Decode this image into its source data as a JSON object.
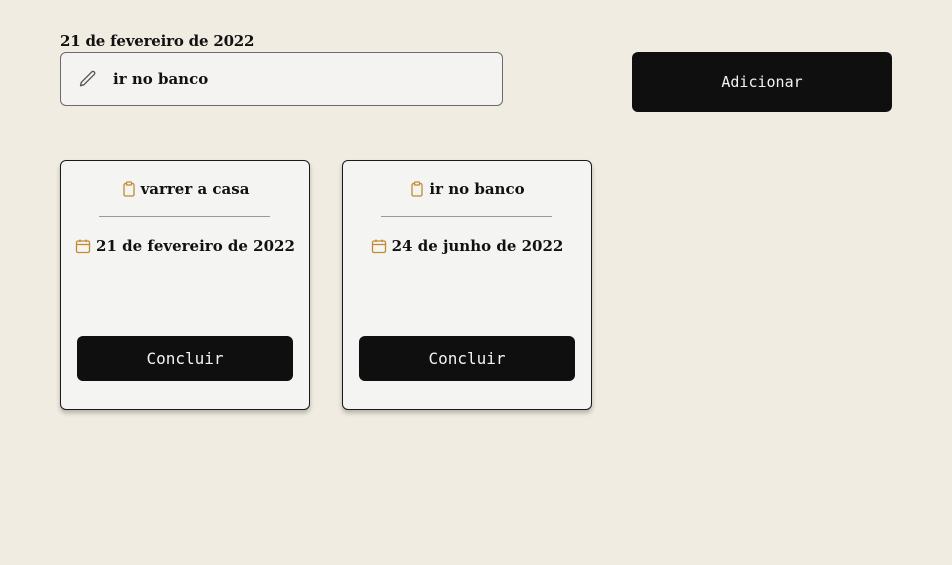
{
  "header": {
    "date_label": "21 de fevereiro de 2022"
  },
  "task_input": {
    "value": "ir no banco",
    "icon": "pencil-icon"
  },
  "add_button": {
    "label": "Adicionar"
  },
  "cards": [
    {
      "title": "varrer a casa",
      "date": "21 de fevereiro de 2022",
      "button_label": "Concluir"
    },
    {
      "title": "ir no banco",
      "date": "24 de junho de 2022",
      "button_label": "Concluir"
    }
  ],
  "colors": {
    "background": "#f1ece1",
    "button": "#0e0f0e",
    "icon_accent": "#c08a2e",
    "card_background": "#f4f4f3"
  }
}
